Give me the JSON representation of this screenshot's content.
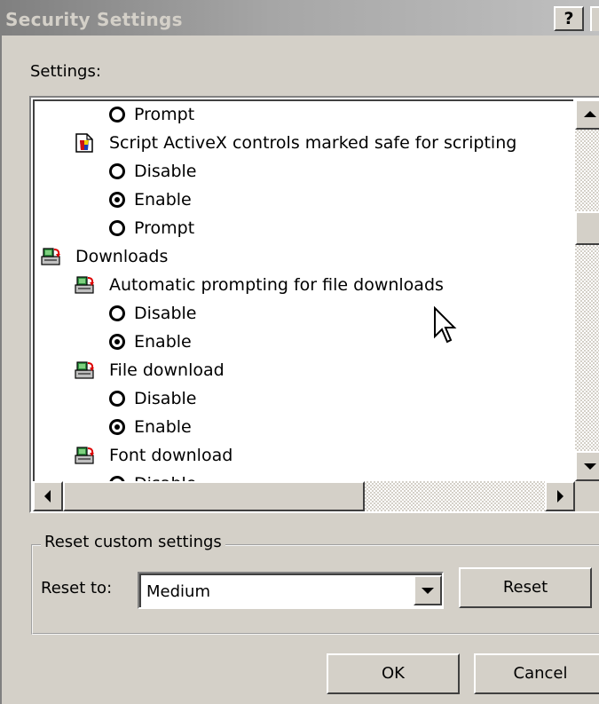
{
  "window": {
    "title": "Security Settings",
    "help_label": "?"
  },
  "settings_label": "Settings:",
  "tree": {
    "rows": [
      {
        "kind": "radio",
        "label": "Prompt",
        "checked": false,
        "indent": 1
      },
      {
        "kind": "item",
        "label": "Script ActiveX controls marked safe for scripting",
        "icon": "activex-icon",
        "indent": 1
      },
      {
        "kind": "radio",
        "label": "Disable",
        "checked": false,
        "indent": 1
      },
      {
        "kind": "radio",
        "label": "Enable",
        "checked": true,
        "indent": 1
      },
      {
        "kind": "radio",
        "label": "Prompt",
        "checked": false,
        "indent": 1
      },
      {
        "kind": "category",
        "label": "Downloads",
        "icon": "download-icon",
        "indent": 0
      },
      {
        "kind": "item",
        "label": "Automatic prompting for file downloads",
        "icon": "download-icon",
        "indent": 1
      },
      {
        "kind": "radio",
        "label": "Disable",
        "checked": false,
        "indent": 1
      },
      {
        "kind": "radio",
        "label": "Enable",
        "checked": true,
        "indent": 1
      },
      {
        "kind": "item",
        "label": "File download",
        "icon": "download-icon",
        "indent": 1
      },
      {
        "kind": "radio",
        "label": "Disable",
        "checked": false,
        "indent": 1
      },
      {
        "kind": "radio",
        "label": "Enable",
        "checked": true,
        "indent": 1
      },
      {
        "kind": "item",
        "label": "Font download",
        "icon": "download-icon",
        "indent": 1
      },
      {
        "kind": "radio",
        "label": "Disable",
        "checked": false,
        "indent": 1
      }
    ]
  },
  "reset_group": {
    "legend": "Reset custom settings",
    "reset_to_label": "Reset to:",
    "selected_level": "Medium",
    "reset_button": "Reset"
  },
  "footer": {
    "ok_label": "OK",
    "cancel_label": "Cancel"
  }
}
